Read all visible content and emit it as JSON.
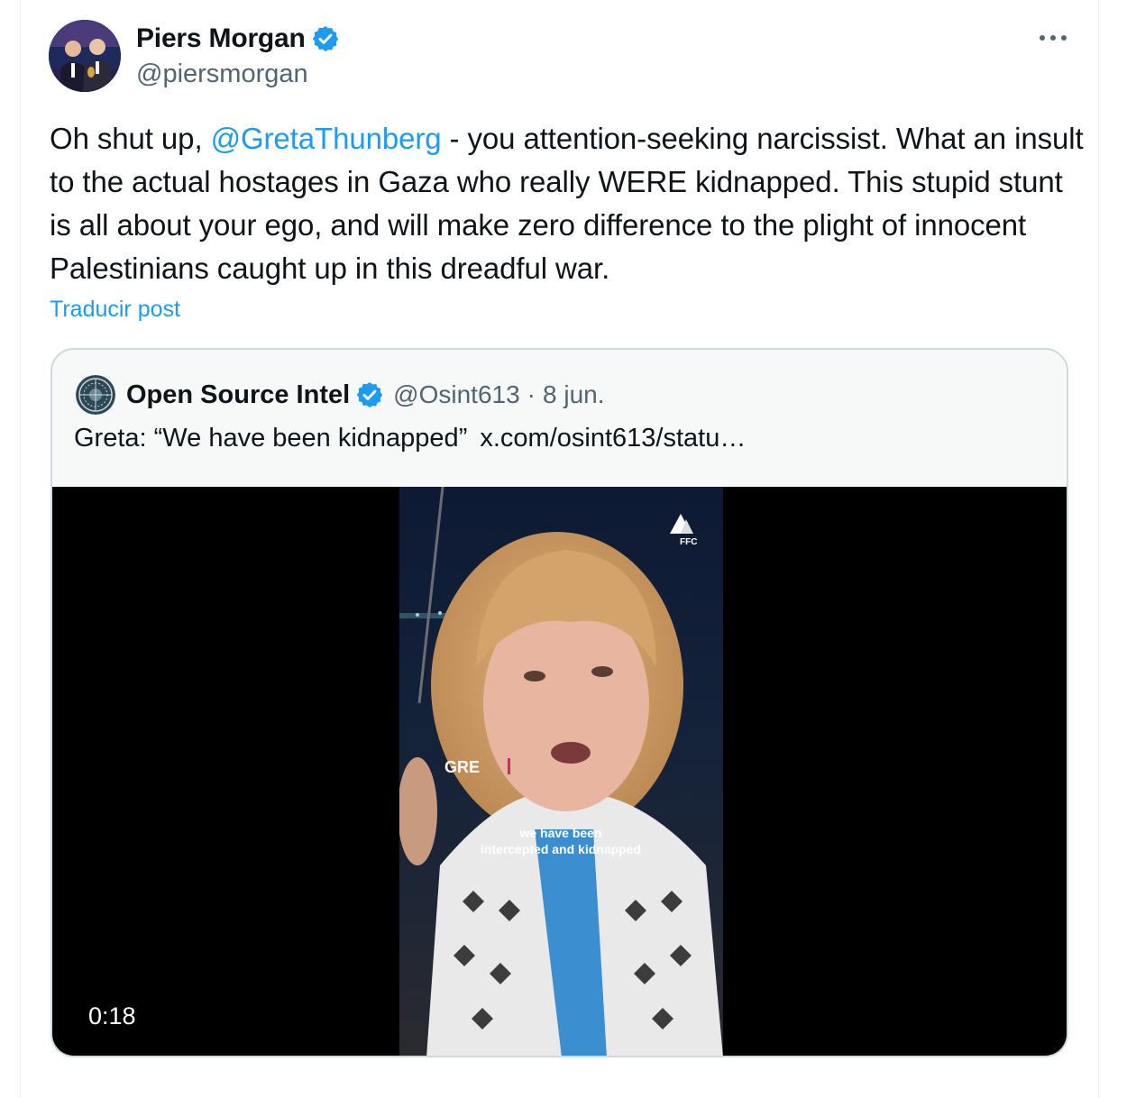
{
  "author": {
    "name": "Piers Morgan",
    "handle": "@piersmorgan",
    "verified_icon": "verified-badge-icon"
  },
  "tweet": {
    "text_before": "Oh shut up, ",
    "mention": "@GretaThunberg",
    "text_after": " - you attention-seeking narcissist. What an insult to the actual hostages in Gaza who really WERE kidnapped. This stupid stunt is all about your ego, and will make zero difference to the plight of innocent Palestinians caught up in this dreadful war.",
    "translate_label": "Traducir post"
  },
  "quote": {
    "name": "Open Source Intel",
    "handle": "@Osint613",
    "separator": "·",
    "date": "8 jun.",
    "text": "Greta: “We have been kidnapped”",
    "link": "x.com/osint613/statu…",
    "video": {
      "duration": "0:18",
      "overlay_logo": "FFC",
      "overlay_title": "GRE",
      "subtitle_line1": "we have been",
      "subtitle_line2": "intercepted and kidnapped"
    }
  },
  "colors": {
    "accent": "#1d9bf0",
    "text": "#0f1419",
    "secondary": "#536471",
    "border": "#cfd9de"
  }
}
